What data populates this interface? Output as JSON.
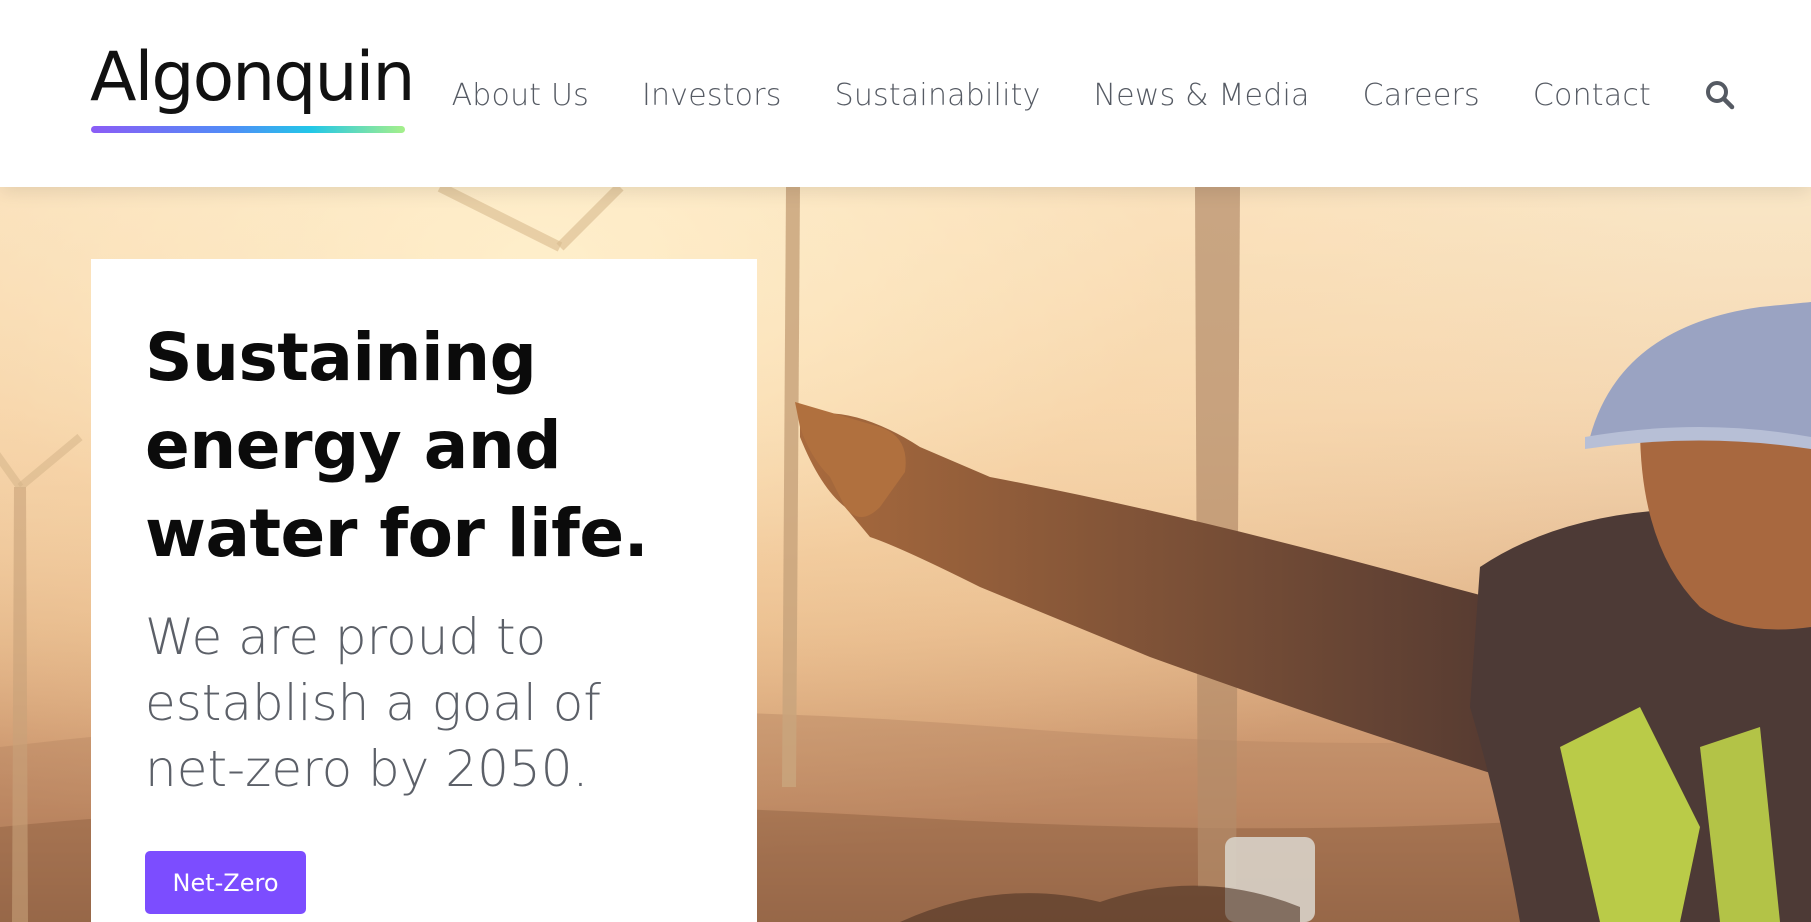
{
  "header": {
    "logo_text": "Algonquin",
    "nav_items": [
      "About Us",
      "Investors",
      "Sustainability",
      "News & Media",
      "Careers",
      "Contact"
    ]
  },
  "hero": {
    "headline": "Sustaining energy and water for life.",
    "subtext": "We are proud to establish a goal of net-zero by 2050.",
    "cta_label": "Net-Zero"
  },
  "icons": {
    "search": "search-icon"
  },
  "colors": {
    "cta_background": "#7c4dff",
    "headline": "#0b0b0b",
    "subtext": "#5c6068",
    "nav_text": "#555a63"
  }
}
